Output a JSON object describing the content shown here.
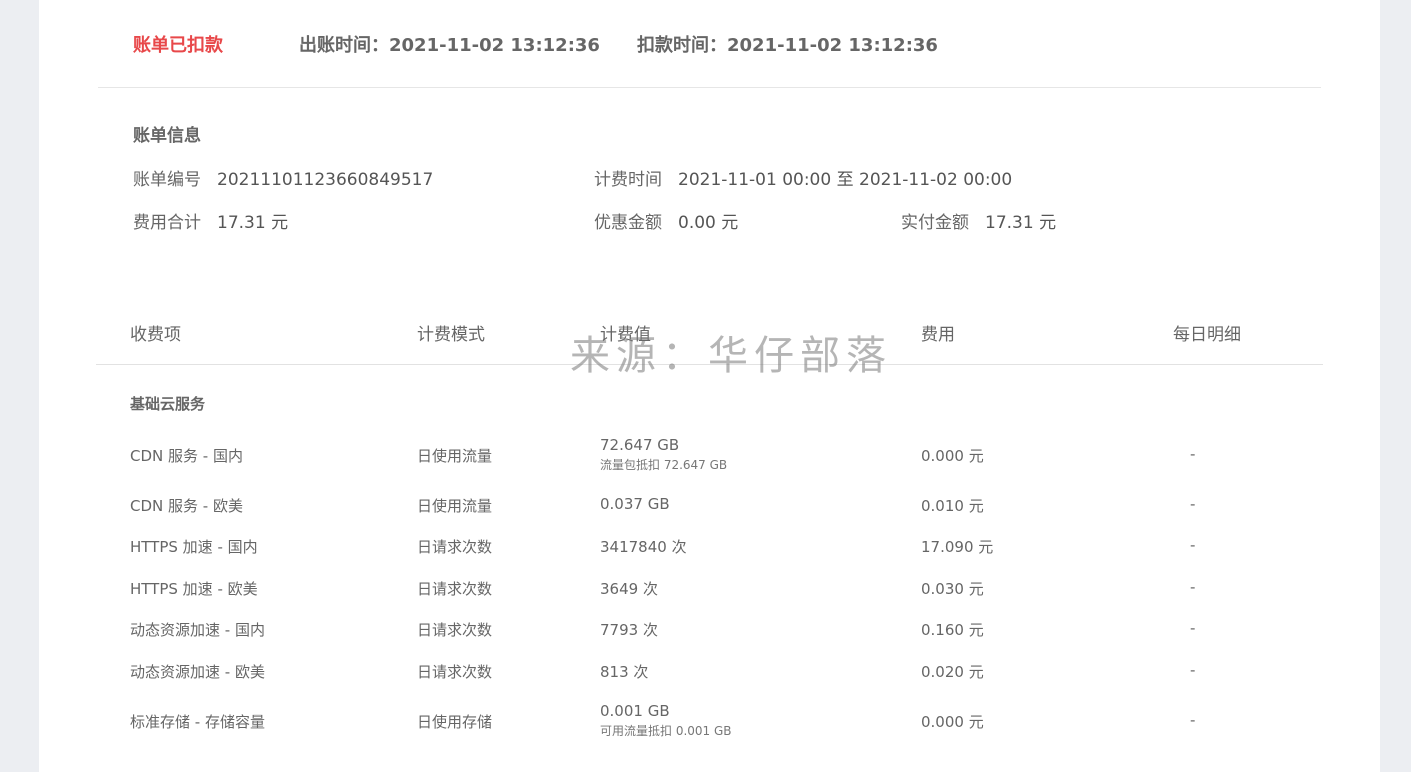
{
  "status": {
    "label": "账单已扣款",
    "issue_time": "出账时间：2021-11-02 13:12:36",
    "deduct_time": "扣款时间：2021-11-02 13:12:36"
  },
  "bill_info": {
    "title": "账单信息",
    "bill_no_label": "账单编号",
    "bill_no": "20211101123660849517",
    "billing_period_label": "计费时间",
    "billing_period": "2021-11-01 00:00 至 2021-11-02 00:00",
    "total_label": "费用合计",
    "total": "17.31 元",
    "discount_label": "优惠金额",
    "discount": "0.00 元",
    "paid_label": "实付金额",
    "paid": "17.31 元"
  },
  "table": {
    "headers": [
      "收费项",
      "计费模式",
      "计费值",
      "费用",
      "每日明细"
    ],
    "group_title": "基础云服务",
    "rows": [
      {
        "item": "CDN 服务 - 国内",
        "mode": "日使用流量",
        "value": "72.647 GB",
        "value_sub": "流量包抵扣 72.647 GB",
        "fee": "0.000 元",
        "detail": "-"
      },
      {
        "item": "CDN 服务 - 欧美",
        "mode": "日使用流量",
        "value": "0.037 GB",
        "value_sub": "",
        "fee": "0.010 元",
        "detail": "-"
      },
      {
        "item": "HTTPS 加速 - 国内",
        "mode": "日请求次数",
        "value": "3417840 次",
        "value_sub": "",
        "fee": "17.090 元",
        "detail": "-"
      },
      {
        "item": "HTTPS 加速 - 欧美",
        "mode": "日请求次数",
        "value": "3649 次",
        "value_sub": "",
        "fee": "0.030 元",
        "detail": "-"
      },
      {
        "item": "动态资源加速 - 国内",
        "mode": "日请求次数",
        "value": "7793 次",
        "value_sub": "",
        "fee": "0.160 元",
        "detail": "-"
      },
      {
        "item": "动态资源加速 - 欧美",
        "mode": "日请求次数",
        "value": "813 次",
        "value_sub": "",
        "fee": "0.020 元",
        "detail": "-"
      },
      {
        "item": "标准存储 - 存储容量",
        "mode": "日使用存储",
        "value": "0.001 GB",
        "value_sub": "可用流量抵扣 0.001 GB",
        "fee": "0.000 元",
        "detail": "-"
      }
    ]
  },
  "watermark": "来源：华仔部落",
  "colors": {
    "status_red": "#e8484a",
    "background": "#eceef2"
  }
}
